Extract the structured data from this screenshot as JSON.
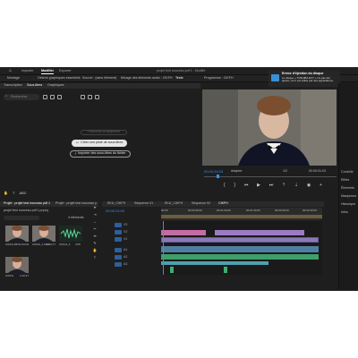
{
  "app": {
    "title": "projet test nouveau pdf 1 - Modifié",
    "nav": {
      "home": "",
      "import": "Importer",
      "edit": "Modifier",
      "export": "Exporter"
    }
  },
  "menu": {
    "items": [
      "Montage",
      "Obtenir graphiques essentiels",
      "Source : (sans élément)",
      "Mixage des éléments audio : CIKFH",
      "Texte",
      "Programme : CIKFH"
    ]
  },
  "text_panel": {
    "tabs": [
      "Transcription",
      "Sous-titres",
      "Graphiques"
    ],
    "active_tab": "Sous-titres",
    "search_placeholder": "Rechercher",
    "transcribe_label": "Transcrire la séquence",
    "create_track_label": "Créer une piste de sous-titres",
    "import_label": "Importer des sous-titres du fichier"
  },
  "notification": {
    "title": "Erreur d'éjection du disque",
    "body": "Le disque « TOSHIBA EXT » n'a pas été éjecté, car il est utilisé par des applications."
  },
  "program_monitor": {
    "timecode_left": "00:00:24:03",
    "fit": "Adapter",
    "ratio": "1/2",
    "timecode_right": "00:00:01:03"
  },
  "right_panel": {
    "items": [
      "Contrôle",
      "Effets",
      "Éléments",
      "Marqueurs",
      "Historique",
      "Infos"
    ]
  },
  "project": {
    "tab": "Projet : projet test nouveau pdf 1",
    "tab2": "Projet : projet test nouveau p",
    "file_name": "projet test nouveau pdf 1.prproj",
    "count": "4 éléments",
    "clips": [
      {
        "name": "CIKFH.MP4",
        "duration": "2:33:09"
      },
      {
        "name": "CIKFH_1.MP4",
        "duration": "2:10:17"
      },
      {
        "name": "CIKFH_2",
        "duration": "3:05"
      },
      {
        "name": "CIKFH",
        "duration": "2:10:17"
      }
    ]
  },
  "sequence": {
    "tabs": [
      "EKU_CIKFH",
      "Séquence 01",
      "EKU_CIKFH",
      "Séquence 02",
      "CIKFH"
    ],
    "active_tab": "CIKFH",
    "timecode": "00:00:24:03",
    "ruler_ticks": [
      "00:00",
      "00:00:30:00",
      "00:01:00:00",
      "00:01:30:00",
      "00:02:00:00",
      "00:02:30:00"
    ],
    "tracks": [
      "V3",
      "V2",
      "V1",
      "A1",
      "A2",
      "A3"
    ]
  },
  "colors": {
    "accent": "#2d8ceb",
    "video_clip": "#8a7ab8",
    "audio_clip": "#3f9e6a",
    "timecode": "#3b8ff0"
  }
}
